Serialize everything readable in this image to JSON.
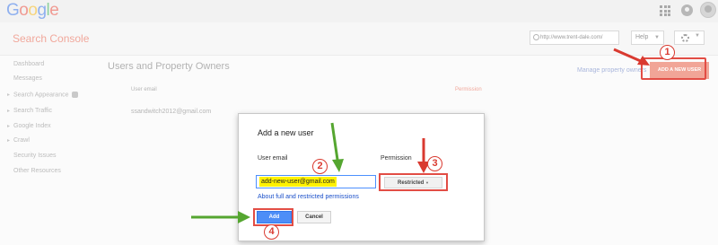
{
  "header": {
    "logo_letters": [
      {
        "char": "G",
        "color": "#8fb0ef"
      },
      {
        "char": "o",
        "color": "#f09a92"
      },
      {
        "char": "o",
        "color": "#f6d57e"
      },
      {
        "char": "g",
        "color": "#8fb0ef"
      },
      {
        "char": "l",
        "color": "#8fd19e"
      },
      {
        "char": "e",
        "color": "#f09a92"
      }
    ],
    "icons": [
      "apps-icon",
      "notifications-icon",
      "avatar"
    ]
  },
  "subbar": {
    "product": "Search Console",
    "property_url": "http://www.trent-dale.com/",
    "help_label": "Help",
    "settings_icon": "gear-icon"
  },
  "sidebar": {
    "items": [
      {
        "label": "Dashboard",
        "expandable": false
      },
      {
        "label": "Messages",
        "expandable": false
      },
      {
        "label": "Search Appearance",
        "expandable": true,
        "info": true
      },
      {
        "label": "Search Traffic",
        "expandable": true
      },
      {
        "label": "Google Index",
        "expandable": true
      },
      {
        "label": "Crawl",
        "expandable": true
      },
      {
        "label": "Security Issues",
        "expandable": false
      },
      {
        "label": "Other Resources",
        "expandable": false
      }
    ]
  },
  "main": {
    "title": "Users and Property Owners",
    "manage_link": "Manage property owners",
    "add_new_user_label": "ADD A NEW USER",
    "columns": {
      "user_email": "User email",
      "permission": "Permission"
    },
    "rows": [
      {
        "email": "ssandwitch2012@gmail.com"
      }
    ]
  },
  "dialog": {
    "title": "Add a new user",
    "email_label": "User email",
    "email_value": "add-new-user@gmail.com",
    "permission_label": "Permission",
    "permission_value": "Restricted",
    "permissions_link": "About full and restricted permissions",
    "add_label": "Add",
    "cancel_label": "Cancel"
  },
  "annotations": {
    "steps": [
      "1",
      "2",
      "3",
      "4"
    ],
    "colors": {
      "red": "#d93a30",
      "green": "#55a630"
    }
  }
}
